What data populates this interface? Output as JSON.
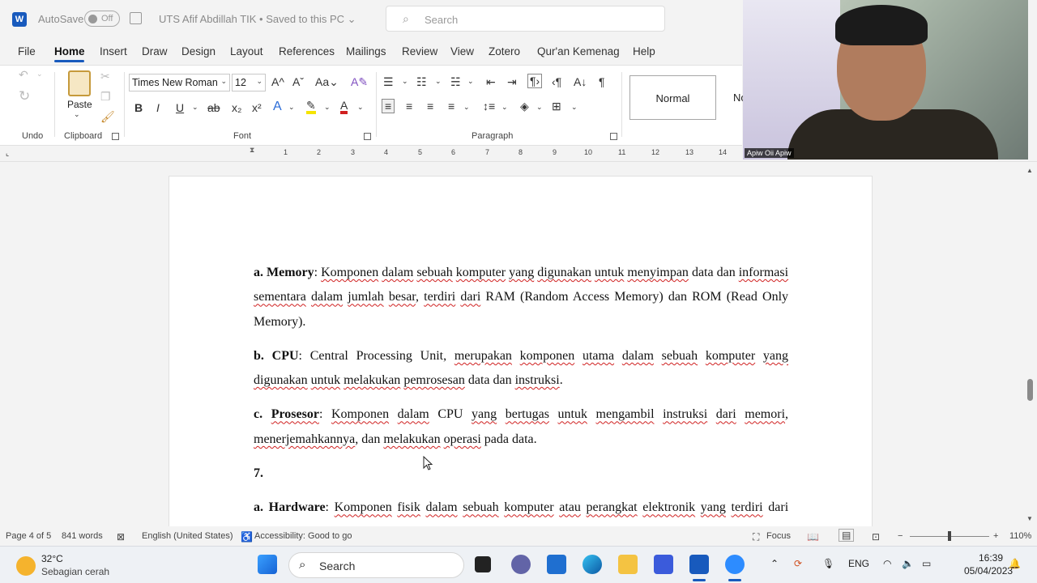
{
  "titlebar": {
    "app_icon": "W",
    "autosave_label": "AutoSave",
    "autosave_state": "Off",
    "document_title": "UTS Afif Abdillah TIK • Saved to this PC ⌄",
    "search_placeholder": "Search"
  },
  "tabs": [
    "File",
    "Home",
    "Insert",
    "Draw",
    "Design",
    "Layout",
    "References",
    "Mailings",
    "Review",
    "View",
    "Zotero",
    "Qur'an Kemenag",
    "Help"
  ],
  "active_tab": "Home",
  "ribbon": {
    "undo_group": "Undo",
    "clipboard_group": "Clipboard",
    "paste_label": "Paste",
    "font_group": "Font",
    "font_name": "Times New Roman",
    "font_size": "12",
    "paragraph_group": "Paragraph",
    "style_normal": "Normal",
    "style_next": "No"
  },
  "ruler_numbers": [
    "1",
    "2",
    "3",
    "4",
    "5",
    "6",
    "7",
    "8",
    "9",
    "10",
    "11",
    "12",
    "13",
    "14"
  ],
  "document": {
    "p1_label": "a. Memory",
    "p1_w1": "Komponen",
    "p1_w2": "dalam",
    "p1_w3": "sebuah",
    "p1_w4": "komputer",
    "p1_w5": "yang",
    "p1_w6": "digunakan",
    "p1_w7": "untuk",
    "p1_w8": "menyimpan",
    "p1_rest1": "data dan",
    "p1_w9": "informasi",
    "p1_w10": "sementara",
    "p1_w11": "dalam",
    "p1_w12": "jumlah",
    "p1_w13": "besar",
    "p1_w14": "terdiri",
    "p1_w15": "dari",
    "p1_rest2": "RAM (Random Access Memory) dan ROM (Read Only Memory).",
    "p2_label": "b. CPU",
    "p2_t1": "Central Processing Unit,",
    "p2_w1": "merupakan",
    "p2_w2": "komponen",
    "p2_w3": "utama",
    "p2_w4": "dalam",
    "p2_w5": "sebuah",
    "p2_w6": "komputer",
    "p2_w7": "yang",
    "p2_w8": "digunakan",
    "p2_w9": "untuk",
    "p2_w10": "melakukan",
    "p2_w11": "pemrosesan",
    "p2_t2": "data dan",
    "p2_w12": "instruksi",
    "p3_label_a": "c.",
    "p3_label_b": "Prosesor",
    "p3_w1": "Komponen",
    "p3_w2": "dalam",
    "p3_t1": "CPU",
    "p3_w3": "yang",
    "p3_w4": "bertugas",
    "p3_w5": "untuk",
    "p3_w6": "mengambil",
    "p3_w7": "instruksi",
    "p3_w8": "dari",
    "p3_w9": "memori",
    "p3_w10": "menerjemahkannya",
    "p3_t2": "dan",
    "p3_w11": "melakukan",
    "p3_w12": "operasi",
    "p3_t3": "pada data.",
    "p4_num": "7.",
    "p5_label": "a. Hardware",
    "p5_w1": "Komponen",
    "p5_w2": "fisik",
    "p5_w3": "dalam",
    "p5_w4": "sebuah",
    "p5_w5": "komputer",
    "p5_w6": "atau",
    "p5_w7": "perangkat",
    "p5_w8": "elektronik",
    "p5_w9": "yang",
    "p5_w10": "terdiri",
    "p5_rest": "dari CPU, memori, hard drive, dan lain-lain."
  },
  "statusbar": {
    "page": "Page 4 of 5",
    "words": "841 words",
    "language": "English (United States)",
    "accessibility": "Accessibility: Good to go",
    "focus": "Focus",
    "zoom": "110%"
  },
  "taskbar": {
    "temperature": "32°C",
    "condition": "Sebagian cerah",
    "search": "Search",
    "language": "ENG",
    "time": "16:39",
    "date": "05/04/2023"
  },
  "webcam": {
    "participant_name": "Apiw Oii Apiw"
  },
  "colors": {
    "word_blue": "#185abd",
    "spell_red": "#d02020"
  }
}
